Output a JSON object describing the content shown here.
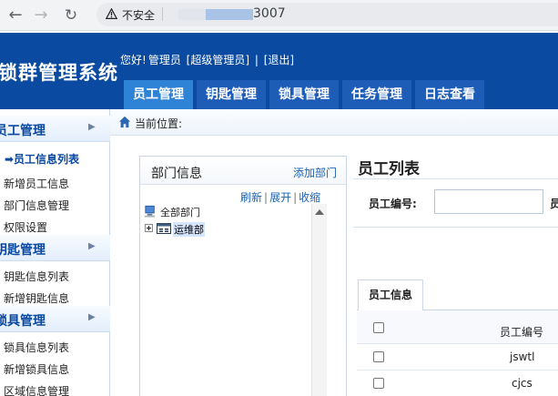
{
  "browser": {
    "security_label": "不安全",
    "url_visible_suffix": "3007"
  },
  "header": {
    "app_title": "锁群管理系统",
    "greeting_prefix": "您好!",
    "user_name": "管理员",
    "user_role": "[超级管理员]",
    "separator": "|",
    "logout_label": "[退出]",
    "tabs": [
      {
        "label": "员工管理",
        "active": true
      },
      {
        "label": "钥匙管理",
        "active": false
      },
      {
        "label": "锁具管理",
        "active": false
      },
      {
        "label": "任务管理",
        "active": false
      },
      {
        "label": "日志查看",
        "active": false
      }
    ]
  },
  "sidebar": {
    "groups": [
      {
        "title": "员工管理",
        "items": [
          {
            "label": "➡员工信息列表",
            "active": true
          },
          {
            "label": "新增员工信息",
            "active": false
          },
          {
            "label": "部门信息管理",
            "active": false
          },
          {
            "label": "权限设置",
            "active": false
          }
        ]
      },
      {
        "title": "钥匙管理",
        "items": [
          {
            "label": "钥匙信息列表",
            "active": false
          },
          {
            "label": "新增钥匙信息",
            "active": false
          }
        ]
      },
      {
        "title": "锁具管理",
        "items": [
          {
            "label": "锁具信息列表",
            "active": false
          },
          {
            "label": "新增锁具信息",
            "active": false
          },
          {
            "label": "区域信息管理",
            "active": false
          }
        ]
      }
    ]
  },
  "breadcrumb": {
    "label": "当前位置:"
  },
  "department_panel": {
    "title": "部门信息",
    "add_label": "添加部门",
    "actions": [
      "刷新",
      "展开",
      "收缩"
    ],
    "tree": {
      "root": "全部部门",
      "children": [
        "运维部"
      ]
    }
  },
  "employee_list": {
    "title": "员工列表",
    "search_label": "员工编号:",
    "search_value": "",
    "extra_label": "员",
    "tab_label": "员工信息",
    "columns": [
      "员工编号"
    ],
    "rows": [
      {
        "employee_id": "jswtl"
      },
      {
        "employee_id": "cjcs"
      }
    ]
  },
  "colors": {
    "header_bg": "#0a4aa0",
    "active_tab": "#2f83d6",
    "link": "#1d63b3",
    "sidebar_title": "#0b49a0"
  }
}
